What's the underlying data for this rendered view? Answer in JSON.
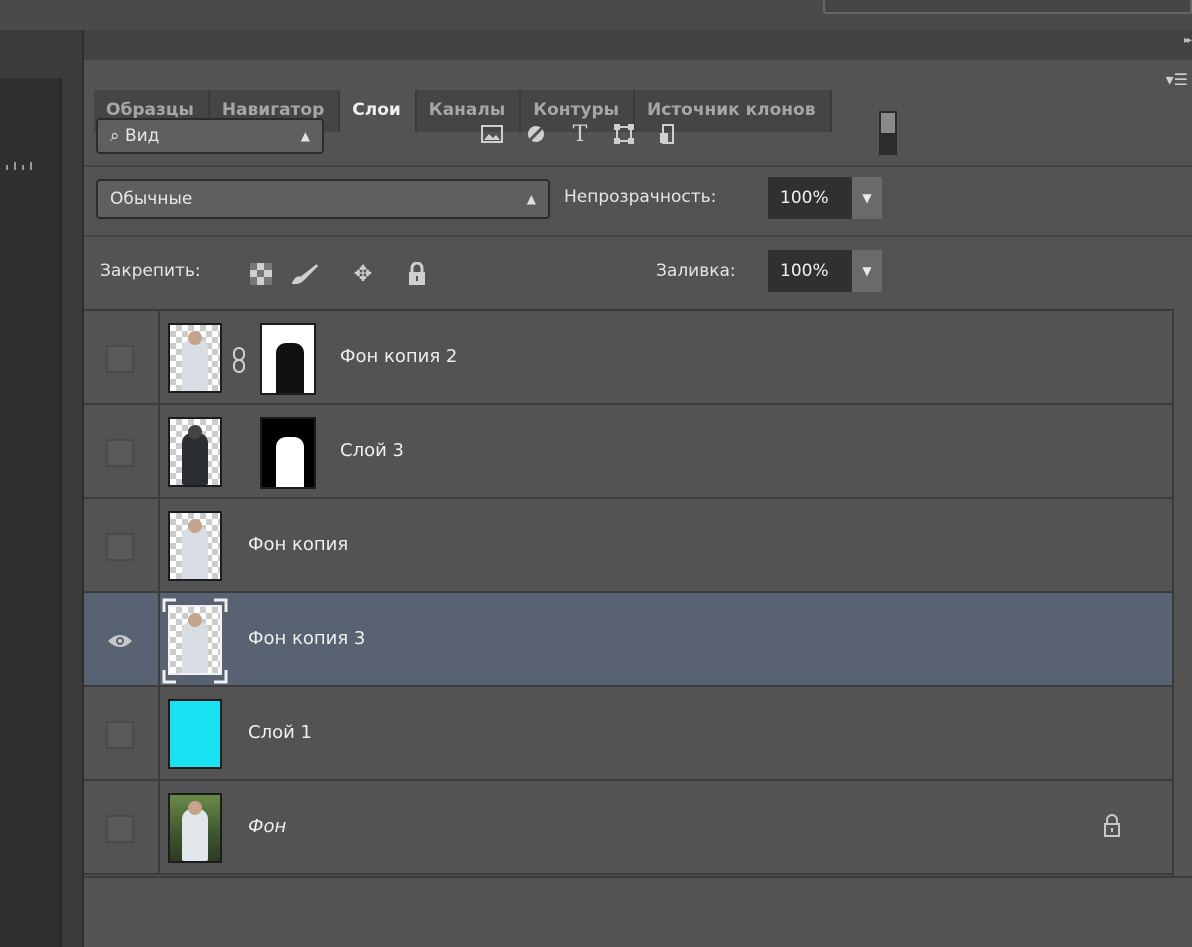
{
  "tabs": [
    {
      "label": "Образцы"
    },
    {
      "label": "Навигатор"
    },
    {
      "label": "Слои"
    },
    {
      "label": "Каналы"
    },
    {
      "label": "Контуры"
    },
    {
      "label": "Источник клонов"
    }
  ],
  "active_tab": "Слои",
  "filter": {
    "kind_label": "Вид",
    "kind_icon": "search-icon",
    "filter_icons": [
      "image-filter-icon",
      "adjustment-filter-icon",
      "type-filter-icon",
      "shape-filter-icon",
      "smart-object-filter-icon"
    ]
  },
  "blend": {
    "mode": "Обычные",
    "opacity_label": "Непрозрачность:",
    "opacity_value": "100%"
  },
  "lock": {
    "label": "Закрепить:",
    "icons": [
      "lock-transparent-icon",
      "lock-pixels-icon",
      "lock-position-icon",
      "lock-all-icon"
    ],
    "fill_label": "Заливка:",
    "fill_value": "100%"
  },
  "layers": [
    {
      "name": "Фон копия 2",
      "visible": false,
      "has_mask": true,
      "linked": true,
      "thumb": "cutout",
      "mask": "light"
    },
    {
      "name": "Слой 3",
      "visible": false,
      "has_mask": true,
      "linked": false,
      "thumb": "dark",
      "mask": "dark"
    },
    {
      "name": "Фон копия",
      "visible": false,
      "has_mask": false,
      "thumb": "cutout"
    },
    {
      "name": "Фон копия 3",
      "visible": true,
      "selected": true,
      "has_mask": false,
      "thumb": "cutout"
    },
    {
      "name": "Слой 1",
      "visible": false,
      "has_mask": false,
      "thumb": "cyan",
      "fill_color": "#19e3f2"
    },
    {
      "name": "Фон",
      "visible": false,
      "has_mask": false,
      "thumb": "photo",
      "italic": true,
      "locked": true
    }
  ],
  "colors": {
    "panel": "#535353",
    "selected_row": "#586273",
    "cyan_layer": "#19e3f2"
  }
}
